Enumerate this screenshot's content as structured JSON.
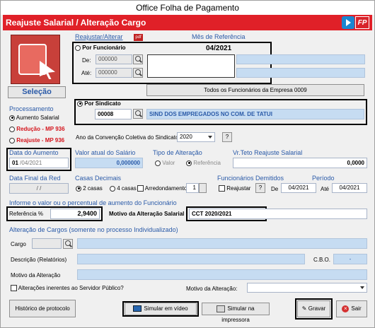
{
  "window": {
    "title": "Office Folha de Pagamento",
    "header": "Reajuste Salarial / Alteração Cargo",
    "badge": "FP"
  },
  "reajustar": {
    "label": "Reajustar/Alterar",
    "mes_label": "Mês de Referência",
    "mes_value": "04/2021",
    "por_funcionario": "Por Funcionário",
    "de_label": "De:",
    "de_value": "000000",
    "ate_label": "Até:",
    "ate_value": "000000",
    "todos_button": "Todos os Funcionários da Empresa 0009",
    "por_sindicato": "Por Sindicato",
    "sindicato_code": "00008",
    "sindicato_name": "SIND DOS EMPREGADOS NO COM. DE TATUI",
    "ano_label": "Ano da Convenção Coletiva do Sindicato:",
    "ano_value": "2020",
    "help": "?"
  },
  "left": {
    "selecao": "Seleção",
    "processamento": "Processamento",
    "opt1": "Aumento Salarial",
    "opt2": "Redução - MP 936",
    "opt3": "Reajuste - MP 936",
    "data_aumento_label": "Data do Aumento",
    "data_aumento_day": "01",
    "data_aumento_rest": "/04/2021",
    "data_final_label": "Data Final da Red",
    "data_final_value": "/ /"
  },
  "middle": {
    "valor_atual_label": "Valor atual do Salário",
    "valor_atual_value": "0,000000",
    "tipo_label": "Tipo de Alteração",
    "tipo_valor": "Valor",
    "tipo_ref": "Referência",
    "teto_label": "Vr.Teto Reajuste Salarial",
    "teto_value": "0,0000",
    "casas_label": "Casas Decimais",
    "casas_2": "2 casas",
    "casas_4": "4 casas",
    "arred_label": "Arredondamento",
    "arred_value": "1",
    "demitidos_label": "Funcionários Demitidos",
    "reajustar_label": "Reajustar",
    "periodo_label": "Período",
    "de": "De",
    "periodo_de": "04/2021",
    "ate": "Até",
    "periodo_ate": "04/2021"
  },
  "percentual": {
    "title": "Informe o valor ou o percentual de aumento do Funcionário",
    "ref_label": "Referência %",
    "ref_value": "2,9400",
    "motivo_label": "Motivo da Alteração Salarial",
    "motivo_value": "CCT 2020/2021"
  },
  "cargos": {
    "title": "Alteração de Cargos (somente no processo Individualizado)",
    "cargo_label": "Cargo",
    "descricao_label": "Descrição (Relatórios)",
    "cbo_label": "C.B.O.",
    "cbo_value": "-",
    "motivo_label": "Motivo da Alteração",
    "inerentes_label": "Alterações inerentes ao Servidor Público?",
    "motivo2_label": "Motivo da Alteração:"
  },
  "footer": {
    "historico": "Histórico de protocolo",
    "simular_video": "Simular em vídeo",
    "simular_impressora": "Simular na impressora",
    "gravar": "Gravar",
    "sair": "Sair"
  }
}
